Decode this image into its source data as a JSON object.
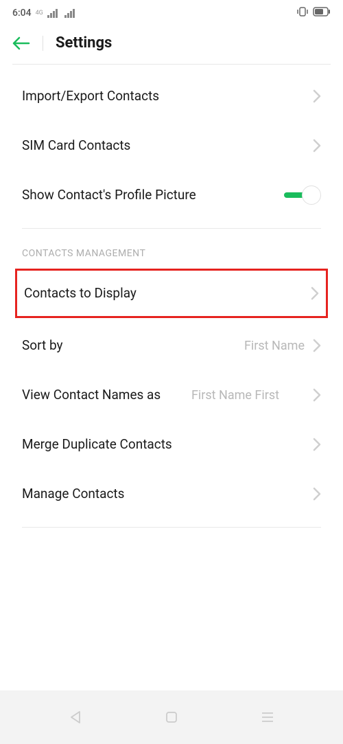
{
  "status": {
    "time": "6:04"
  },
  "header": {
    "title": "Settings"
  },
  "items": {
    "import_export": "Import/Export Contacts",
    "sim_card": "SIM Card Contacts",
    "profile_picture": "Show Contact's Profile Picture"
  },
  "section": {
    "contacts_management": "CONTACTS MANAGEMENT"
  },
  "management": {
    "contacts_display": "Contacts to Display",
    "sort_by": {
      "label": "Sort by",
      "value": "First Name"
    },
    "view_names": {
      "label": "View Contact Names as",
      "value": "First Name First"
    },
    "merge": "Merge Duplicate Contacts",
    "manage": "Manage Contacts"
  }
}
